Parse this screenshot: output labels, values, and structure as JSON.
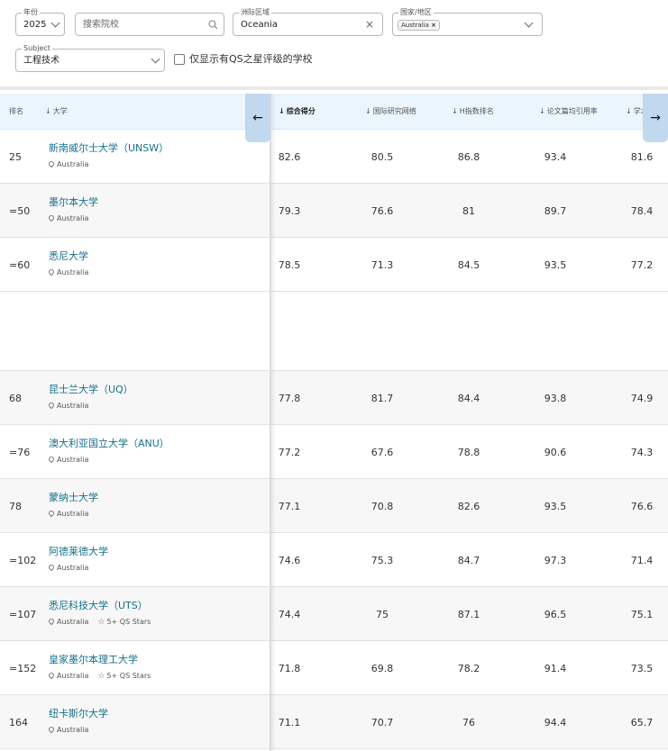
{
  "filters": {
    "year": {
      "legend": "年份",
      "value": "2025"
    },
    "search": {
      "placeholder": "搜索院校"
    },
    "region": {
      "legend": "洲际区域",
      "value": "Oceania"
    },
    "country": {
      "legend": "国家/地区",
      "chip": "Australia"
    },
    "subject": {
      "legend": "Subject",
      "value": "工程技术"
    },
    "stars_only_label": "仅显示有QS之星评级的学校"
  },
  "table": {
    "headers": {
      "rank": "排名",
      "university": "大学",
      "overall": "综合得分",
      "irn": "国际研究网络",
      "hindex": "H指数排名",
      "citations": "论文篇均引用率",
      "academic": "学术"
    },
    "rows": [
      {
        "rank": "25",
        "name": "新南威尔士大学（UNSW）",
        "location": "Australia",
        "stars": "",
        "overall": "82.6",
        "irn": "80.5",
        "hindex": "86.8",
        "citations": "93.4",
        "academic": "81.6"
      },
      {
        "rank": "=50",
        "name": "墨尔本大学",
        "location": "Australia",
        "stars": "",
        "overall": "79.3",
        "irn": "76.6",
        "hindex": "81",
        "citations": "89.7",
        "academic": "78.4"
      },
      {
        "rank": "=60",
        "name": "悉尼大学",
        "location": "Australia",
        "stars": "",
        "overall": "78.5",
        "irn": "71.3",
        "hindex": "84.5",
        "citations": "93.5",
        "academic": "77.2"
      },
      {
        "rank": "68",
        "name": "昆士兰大学（UQ）",
        "location": "Australia",
        "stars": "",
        "overall": "77.8",
        "irn": "81.7",
        "hindex": "84.4",
        "citations": "93.8",
        "academic": "74.9"
      },
      {
        "rank": "=76",
        "name": "澳大利亚国立大学（ANU）",
        "location": "Australia",
        "stars": "",
        "overall": "77.2",
        "irn": "67.6",
        "hindex": "78.8",
        "citations": "90.6",
        "academic": "74.3"
      },
      {
        "rank": "78",
        "name": "蒙纳士大学",
        "location": "Australia",
        "stars": "",
        "overall": "77.1",
        "irn": "70.8",
        "hindex": "82.6",
        "citations": "93.5",
        "academic": "76.6"
      },
      {
        "rank": "=102",
        "name": "阿德莱德大学",
        "location": "Australia",
        "stars": "",
        "overall": "74.6",
        "irn": "75.3",
        "hindex": "84.7",
        "citations": "97.3",
        "academic": "71.4"
      },
      {
        "rank": "=107",
        "name": "悉尼科技大学（UTS）",
        "location": "Australia",
        "stars": "5+ QS Stars",
        "overall": "74.4",
        "irn": "75",
        "hindex": "87.1",
        "citations": "96.5",
        "academic": "75.1"
      },
      {
        "rank": "=152",
        "name": "皇家墨尔本理工大学",
        "location": "Australia",
        "stars": "5+ QS Stars",
        "overall": "71.8",
        "irn": "69.8",
        "hindex": "78.2",
        "citations": "91.4",
        "academic": "73.5"
      },
      {
        "rank": "164",
        "name": "纽卡斯尔大学",
        "location": "Australia",
        "stars": "",
        "overall": "71.1",
        "irn": "70.7",
        "hindex": "76",
        "citations": "94.4",
        "academic": "65.7"
      }
    ]
  }
}
